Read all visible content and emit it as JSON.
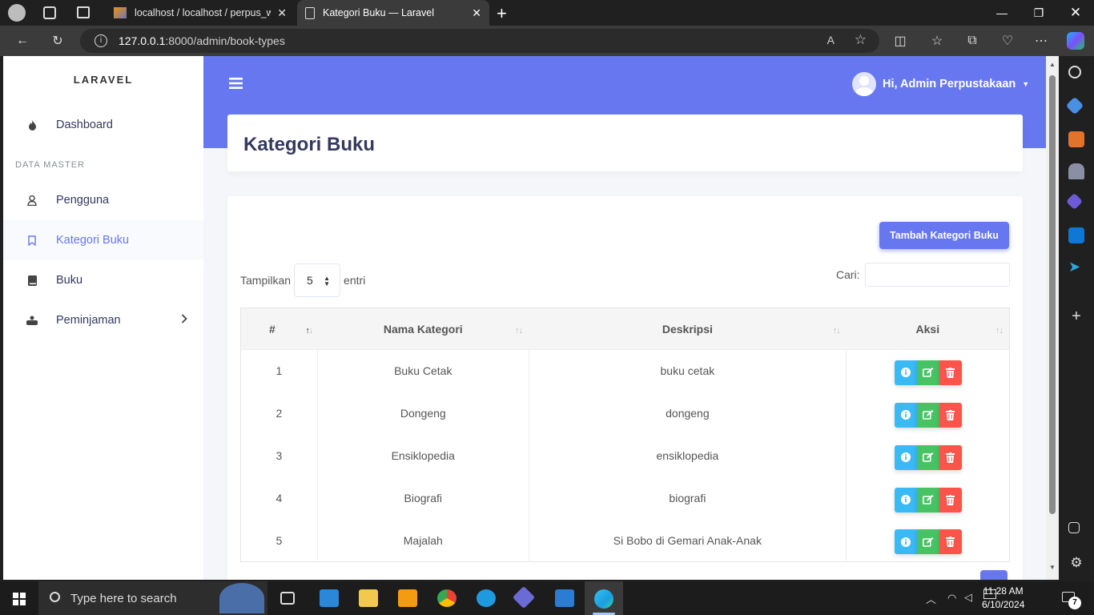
{
  "browser": {
    "tabs": [
      {
        "title": "localhost / localhost / perpus_we"
      },
      {
        "title": "Kategori Buku — Laravel"
      }
    ],
    "url_host": "127.0.0.1",
    "url_rest": ":8000/admin/book-types"
  },
  "sidebar": {
    "brand": "LARAVEL",
    "menu_header": "DATA MASTER",
    "items": [
      {
        "label": "Dashboard",
        "icon": "fire-icon"
      },
      {
        "label": "Pengguna",
        "icon": "user-icon"
      },
      {
        "label": "Kategori Buku",
        "icon": "bookmark-icon",
        "active": true
      },
      {
        "label": "Buku",
        "icon": "book-icon"
      },
      {
        "label": "Peminjaman",
        "icon": "users-icon"
      }
    ]
  },
  "topbar": {
    "user_greeting": "Hi, Admin Perpustakaan"
  },
  "page": {
    "title": "Kategori Buku",
    "add_button": "Tambah Kategori Buku",
    "length_label_before": "Tampilkan",
    "length_value": "5",
    "length_label_after": "entri",
    "search_label": "Cari:"
  },
  "table": {
    "columns": [
      "#",
      "Nama Kategori",
      "Deskripsi",
      "Aksi"
    ],
    "rows": [
      {
        "no": "1",
        "nama": "Buku Cetak",
        "deskripsi": "buku cetak"
      },
      {
        "no": "2",
        "nama": "Dongeng",
        "deskripsi": "dongeng"
      },
      {
        "no": "3",
        "nama": "Ensiklopedia",
        "deskripsi": "ensiklopedia"
      },
      {
        "no": "4",
        "nama": "Biografi",
        "deskripsi": "biografi"
      },
      {
        "no": "5",
        "nama": "Majalah",
        "deskripsi": "Si Bobo di Gemari Anak-Anak"
      }
    ]
  },
  "taskbar": {
    "search_placeholder": "Type here to search",
    "time": "11:28 AM",
    "date": "6/10/2024",
    "notification_count": "7"
  },
  "colors": {
    "primary": "#6777ef",
    "info": "#3abaf4",
    "success": "#47c363",
    "danger": "#fc544b"
  }
}
